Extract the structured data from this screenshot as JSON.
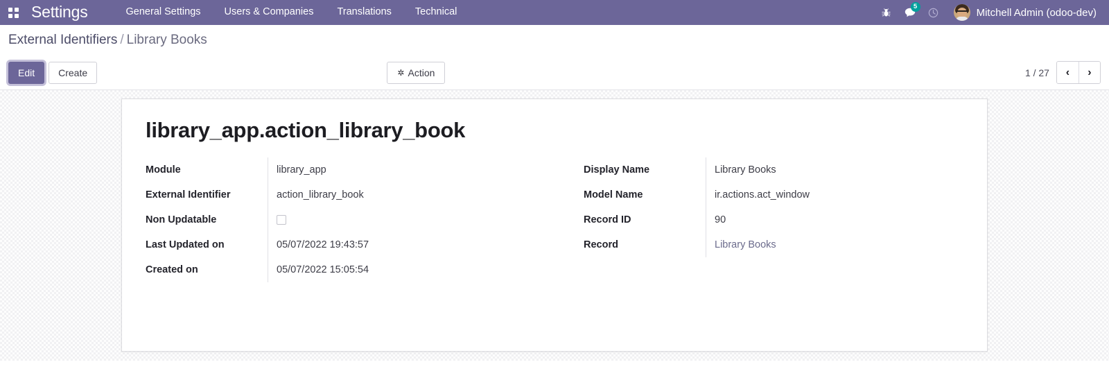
{
  "navbar": {
    "apps_icon": "apps-grid-icon",
    "brand": "Settings",
    "menu": [
      {
        "label": "General Settings"
      },
      {
        "label": "Users & Companies"
      },
      {
        "label": "Translations"
      },
      {
        "label": "Technical"
      }
    ],
    "icons": {
      "debug": "bug-icon",
      "messages": "chat-bubble-icon",
      "messages_badge": "5",
      "activities": "clock-icon"
    },
    "user": {
      "name": "Mitchell Admin (odoo-dev)",
      "avatar": "user-avatar"
    },
    "color": "#6C6699"
  },
  "breadcrumb": {
    "parent": "External Identifiers",
    "separator": "/",
    "current": "Library Books"
  },
  "control_bar": {
    "edit_label": "Edit",
    "create_label": "Create",
    "action_label": "Action",
    "action_icon": "cog-icon",
    "pager": {
      "count": "1 / 27",
      "prev_icon": "‹",
      "next_icon": "›"
    }
  },
  "record": {
    "title": "library_app.action_library_book",
    "left_fields": [
      {
        "label": "Module",
        "value": "library_app",
        "type": "text"
      },
      {
        "label": "External Identifier",
        "value": "action_library_book",
        "type": "text"
      },
      {
        "label": "Non Updatable",
        "value": "",
        "type": "checkbox",
        "checked": false
      },
      {
        "label": "Last Updated on",
        "value": "05/07/2022 19:43:57",
        "type": "text"
      },
      {
        "label": "Created on",
        "value": "05/07/2022 15:05:54",
        "type": "text"
      }
    ],
    "right_fields": [
      {
        "label": "Display Name",
        "value": "Library Books",
        "type": "text"
      },
      {
        "label": "Model Name",
        "value": "ir.actions.act_window",
        "type": "text"
      },
      {
        "label": "Record ID",
        "value": "90",
        "type": "text"
      },
      {
        "label": "Record",
        "value": "Library Books",
        "type": "link"
      }
    ]
  }
}
